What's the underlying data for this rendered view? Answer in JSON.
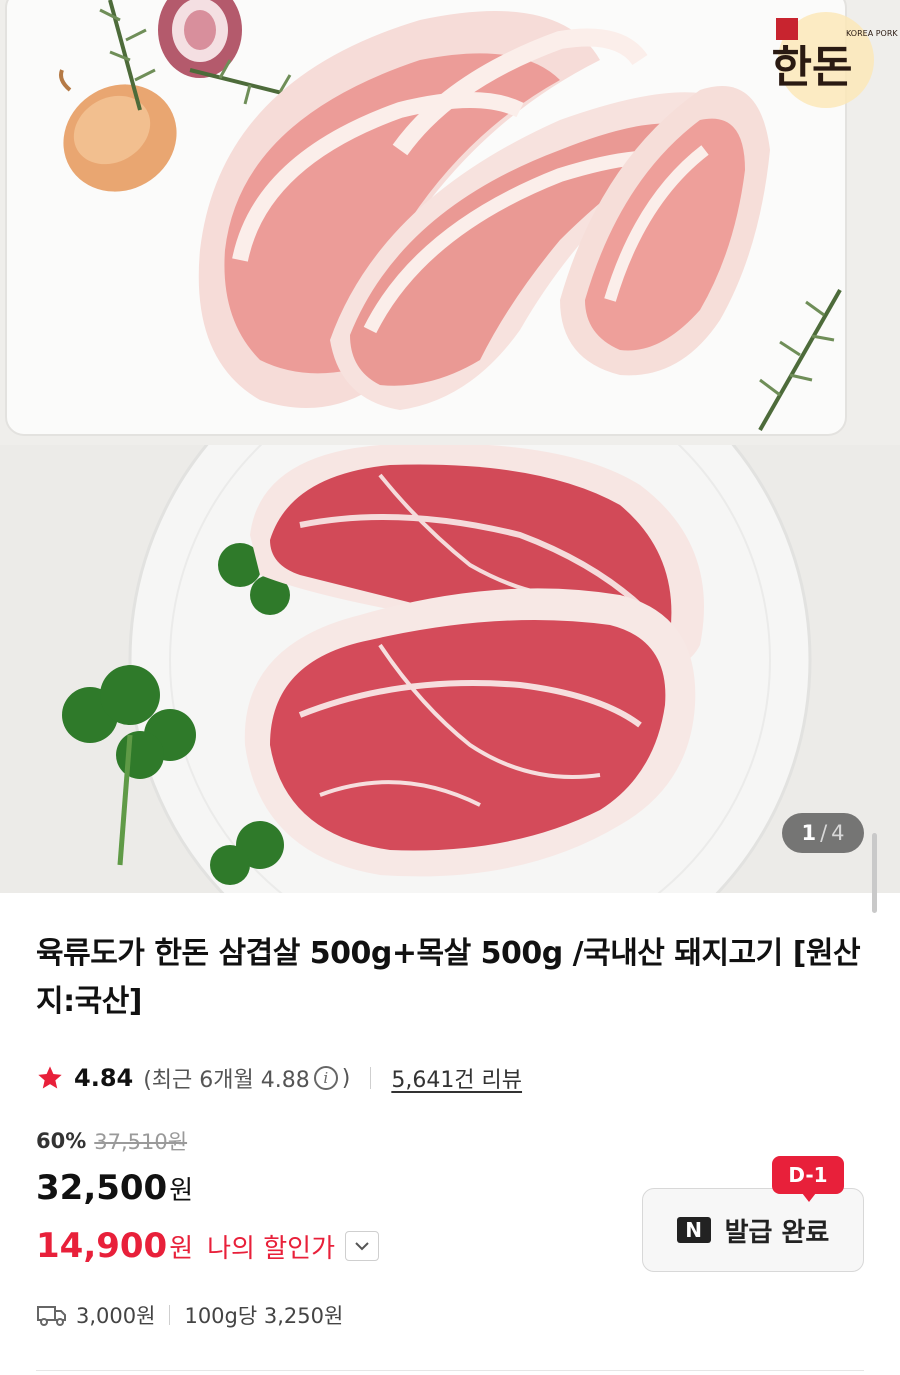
{
  "gallery": {
    "brand_logo_text": "한돈",
    "brand_logo_sub": "KOREA PORK",
    "page_current": "1",
    "page_separator": "/",
    "page_total": "4"
  },
  "product": {
    "title": "육류도가 한돈 삼겹살 500g+목살 500g /국내산 돼지고기 [원산지:국산]",
    "rating": {
      "score": "4.84",
      "recent_prefix": "(최근 6개월 4.88",
      "recent_suffix": ")",
      "reviews": "5,641건 리뷰"
    },
    "price": {
      "discount_rate": "60%",
      "original": "37,510원",
      "sale": "32,500",
      "sale_unit": "원",
      "my_price": "14,900",
      "my_price_unit": "원",
      "my_price_label": "나의 할인가"
    },
    "shipping": {
      "fee": "3,000원",
      "unit_price": "100g당 3,250원"
    }
  },
  "coupon": {
    "logo": "N",
    "label": "발급 완료",
    "badge": "D-1"
  },
  "colors": {
    "accent_red": "#e8203a",
    "star": "#e8203a"
  },
  "icons": [
    "star-icon",
    "info-icon",
    "chevron-down-icon",
    "truck-icon",
    "naver-logo-icon"
  ]
}
